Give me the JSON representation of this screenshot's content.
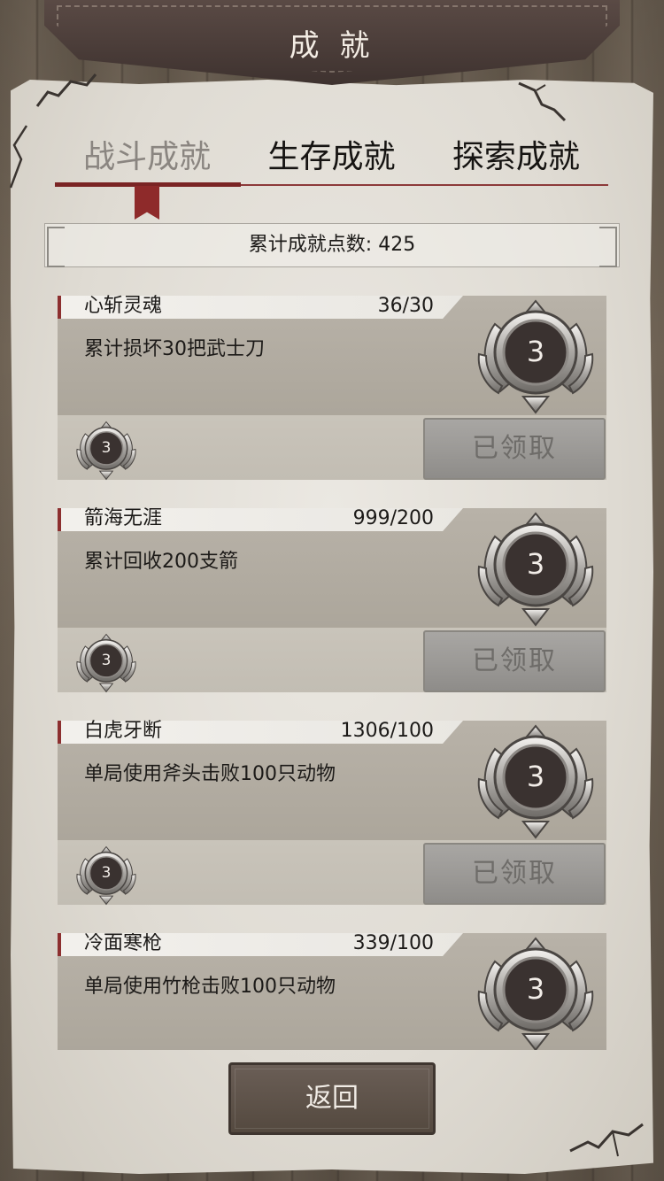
{
  "header": {
    "title": "成 就"
  },
  "tabs": [
    {
      "label": "战斗成就",
      "active": true
    },
    {
      "label": "生存成就",
      "active": false
    },
    {
      "label": "探索成就",
      "active": false
    }
  ],
  "points": {
    "label": "累计成就点数: 425"
  },
  "achievements": [
    {
      "name": "心斩灵魂",
      "progress": "36/30",
      "desc": "累计损坏30把武士刀",
      "reward": "3",
      "reward_small": "3",
      "button": "已领取"
    },
    {
      "name": "箭海无涯",
      "progress": "999/200",
      "desc": "累计回收200支箭",
      "reward": "3",
      "reward_small": "3",
      "button": "已领取"
    },
    {
      "name": "白虎牙断",
      "progress": "1306/100",
      "desc": "单局使用斧头击败100只动物",
      "reward": "3",
      "reward_small": "3",
      "button": "已领取"
    },
    {
      "name": "冷面寒枪",
      "progress": "339/100",
      "desc": "单局使用竹枪击败100只动物",
      "reward": "3"
    }
  ],
  "footer": {
    "back_label": "返回"
  },
  "colors": {
    "accent": "#8c2f2f",
    "banner": "#4a3c38",
    "paper": "#e3dfd8"
  },
  "icons": {
    "medal": "medal-icon",
    "ribbon": "bookmark-icon"
  }
}
